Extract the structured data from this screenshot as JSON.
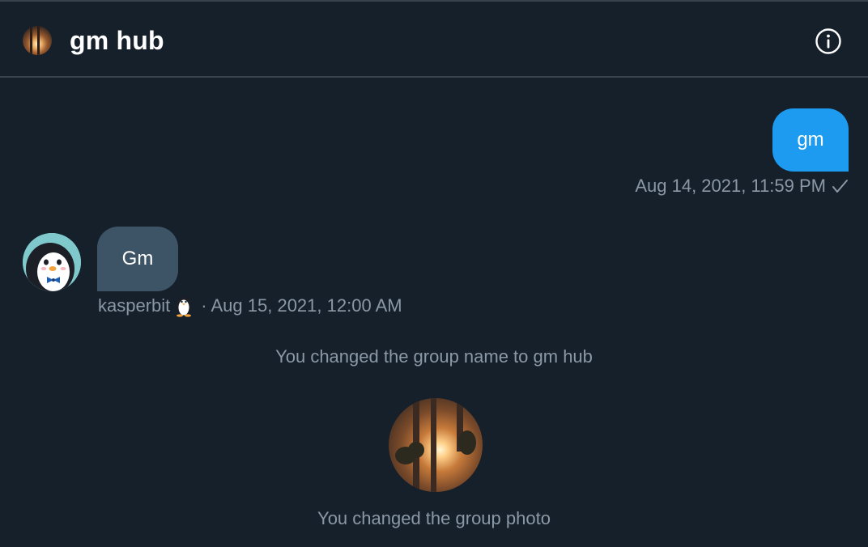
{
  "header": {
    "title": "gm hub",
    "avatar_icon": "group-photo-icon",
    "info_icon": "info-icon"
  },
  "messages": {
    "outgoing": {
      "text": "gm",
      "timestamp": "Aug 14, 2021, 11:59 PM",
      "status_icon": "checkmark-icon"
    },
    "incoming": {
      "text": "Gm",
      "sender": "kasperbit",
      "sender_emoji": "penguin-emoji",
      "timestamp": "· Aug 15, 2021, 12:00 AM"
    }
  },
  "system": {
    "name_change": "You changed the group name to gm hub",
    "photo_change": "You changed the group photo"
  },
  "colors": {
    "background": "#15202b",
    "outgoing_bubble": "#1d9bf0",
    "incoming_bubble": "#3d5466",
    "secondary_text": "#8b98a5",
    "divider": "#38444d"
  }
}
